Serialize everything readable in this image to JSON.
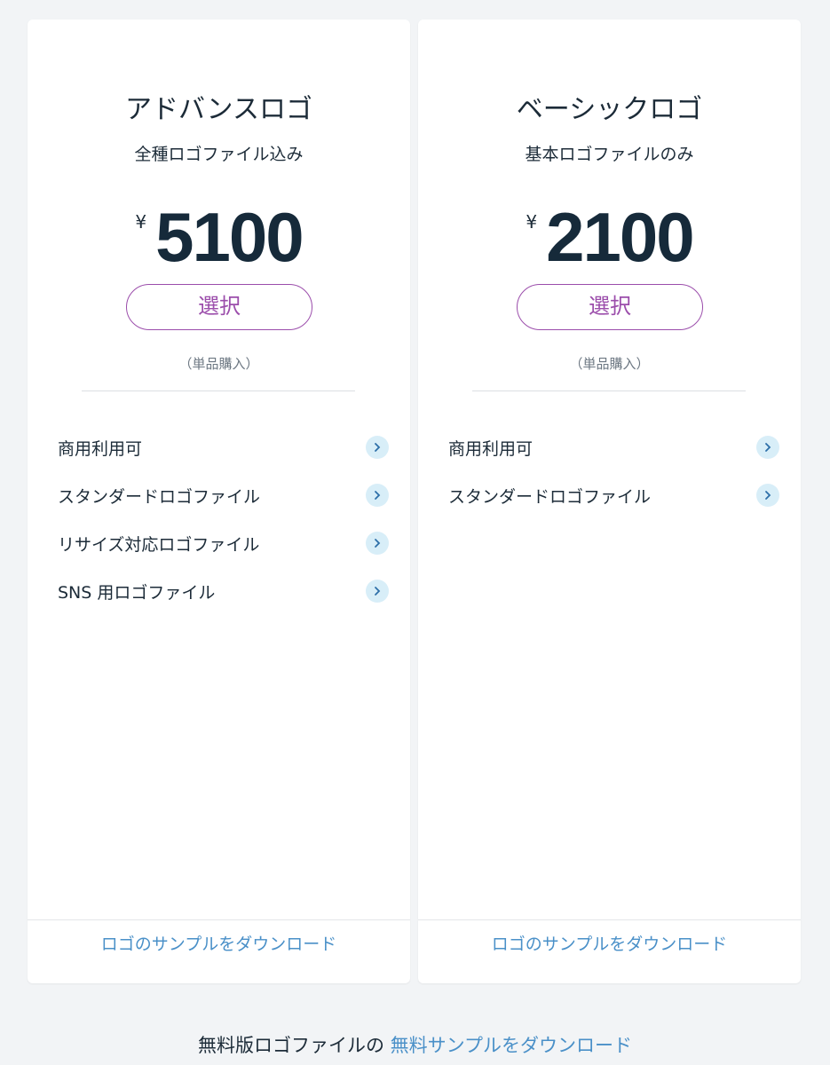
{
  "plans": [
    {
      "title": "アドバンスロゴ",
      "subtitle": "全種ロゴファイル込み",
      "currency": "¥",
      "price": "5100",
      "select_label": "選択",
      "purchase_note": "（単品購入）",
      "features": [
        "商用利用可",
        "スタンダードロゴファイル",
        "リサイズ対応ロゴファイル",
        "SNS 用ロゴファイル"
      ],
      "sample_link": "ロゴのサンプルをダウンロード"
    },
    {
      "title": "ベーシックロゴ",
      "subtitle": "基本ロゴファイルのみ",
      "currency": "¥",
      "price": "2100",
      "select_label": "選択",
      "purchase_note": "（単品購入）",
      "features": [
        "商用利用可",
        "スタンダードロゴファイル"
      ],
      "sample_link": "ロゴのサンプルをダウンロード"
    }
  ],
  "footer": {
    "text": "無料版ロゴファイルの",
    "link": "無料サンプルをダウンロード"
  },
  "colors": {
    "accent_purple": "#9b4dab",
    "link_blue": "#4a90c8",
    "chevron_bg": "#d8eef8",
    "page_bg": "#f2f4f6"
  },
  "icons": {
    "feature_chevron": "chevron-right-icon"
  }
}
